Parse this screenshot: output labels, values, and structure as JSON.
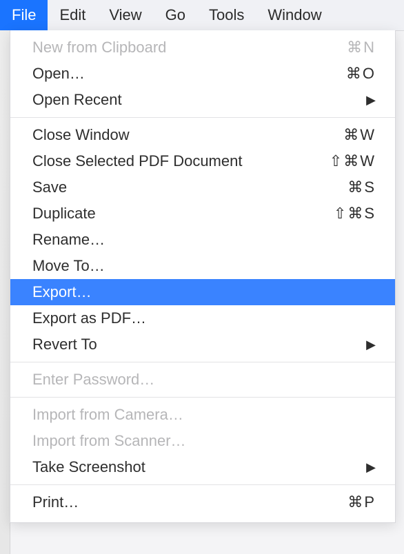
{
  "menubar": {
    "items": [
      {
        "label": "File",
        "selected": true
      },
      {
        "label": "Edit"
      },
      {
        "label": "View"
      },
      {
        "label": "Go"
      },
      {
        "label": "Tools"
      },
      {
        "label": "Window"
      }
    ]
  },
  "dropdown": {
    "groups": [
      [
        {
          "label": "New from Clipboard",
          "shortcut": "⌘N",
          "disabled": true
        },
        {
          "label": "Open…",
          "shortcut": "⌘O"
        },
        {
          "label": "Open Recent",
          "submenu": true
        }
      ],
      [
        {
          "label": "Close Window",
          "shortcut": "⌘W"
        },
        {
          "label": "Close Selected PDF Document",
          "shortcut": "⇧⌘W"
        },
        {
          "label": "Save",
          "shortcut": "⌘S"
        },
        {
          "label": "Duplicate",
          "shortcut": "⇧⌘S"
        },
        {
          "label": "Rename…"
        },
        {
          "label": "Move To…"
        },
        {
          "label": "Export…",
          "highlight": true
        },
        {
          "label": "Export as PDF…"
        },
        {
          "label": "Revert To",
          "submenu": true
        }
      ],
      [
        {
          "label": "Enter Password…",
          "disabled": true
        }
      ],
      [
        {
          "label": "Import from Camera…",
          "disabled": true
        },
        {
          "label": "Import from Scanner…",
          "disabled": true
        },
        {
          "label": "Take Screenshot",
          "submenu": true
        }
      ],
      [
        {
          "label": "Print…",
          "shortcut": "⌘P"
        }
      ]
    ]
  }
}
